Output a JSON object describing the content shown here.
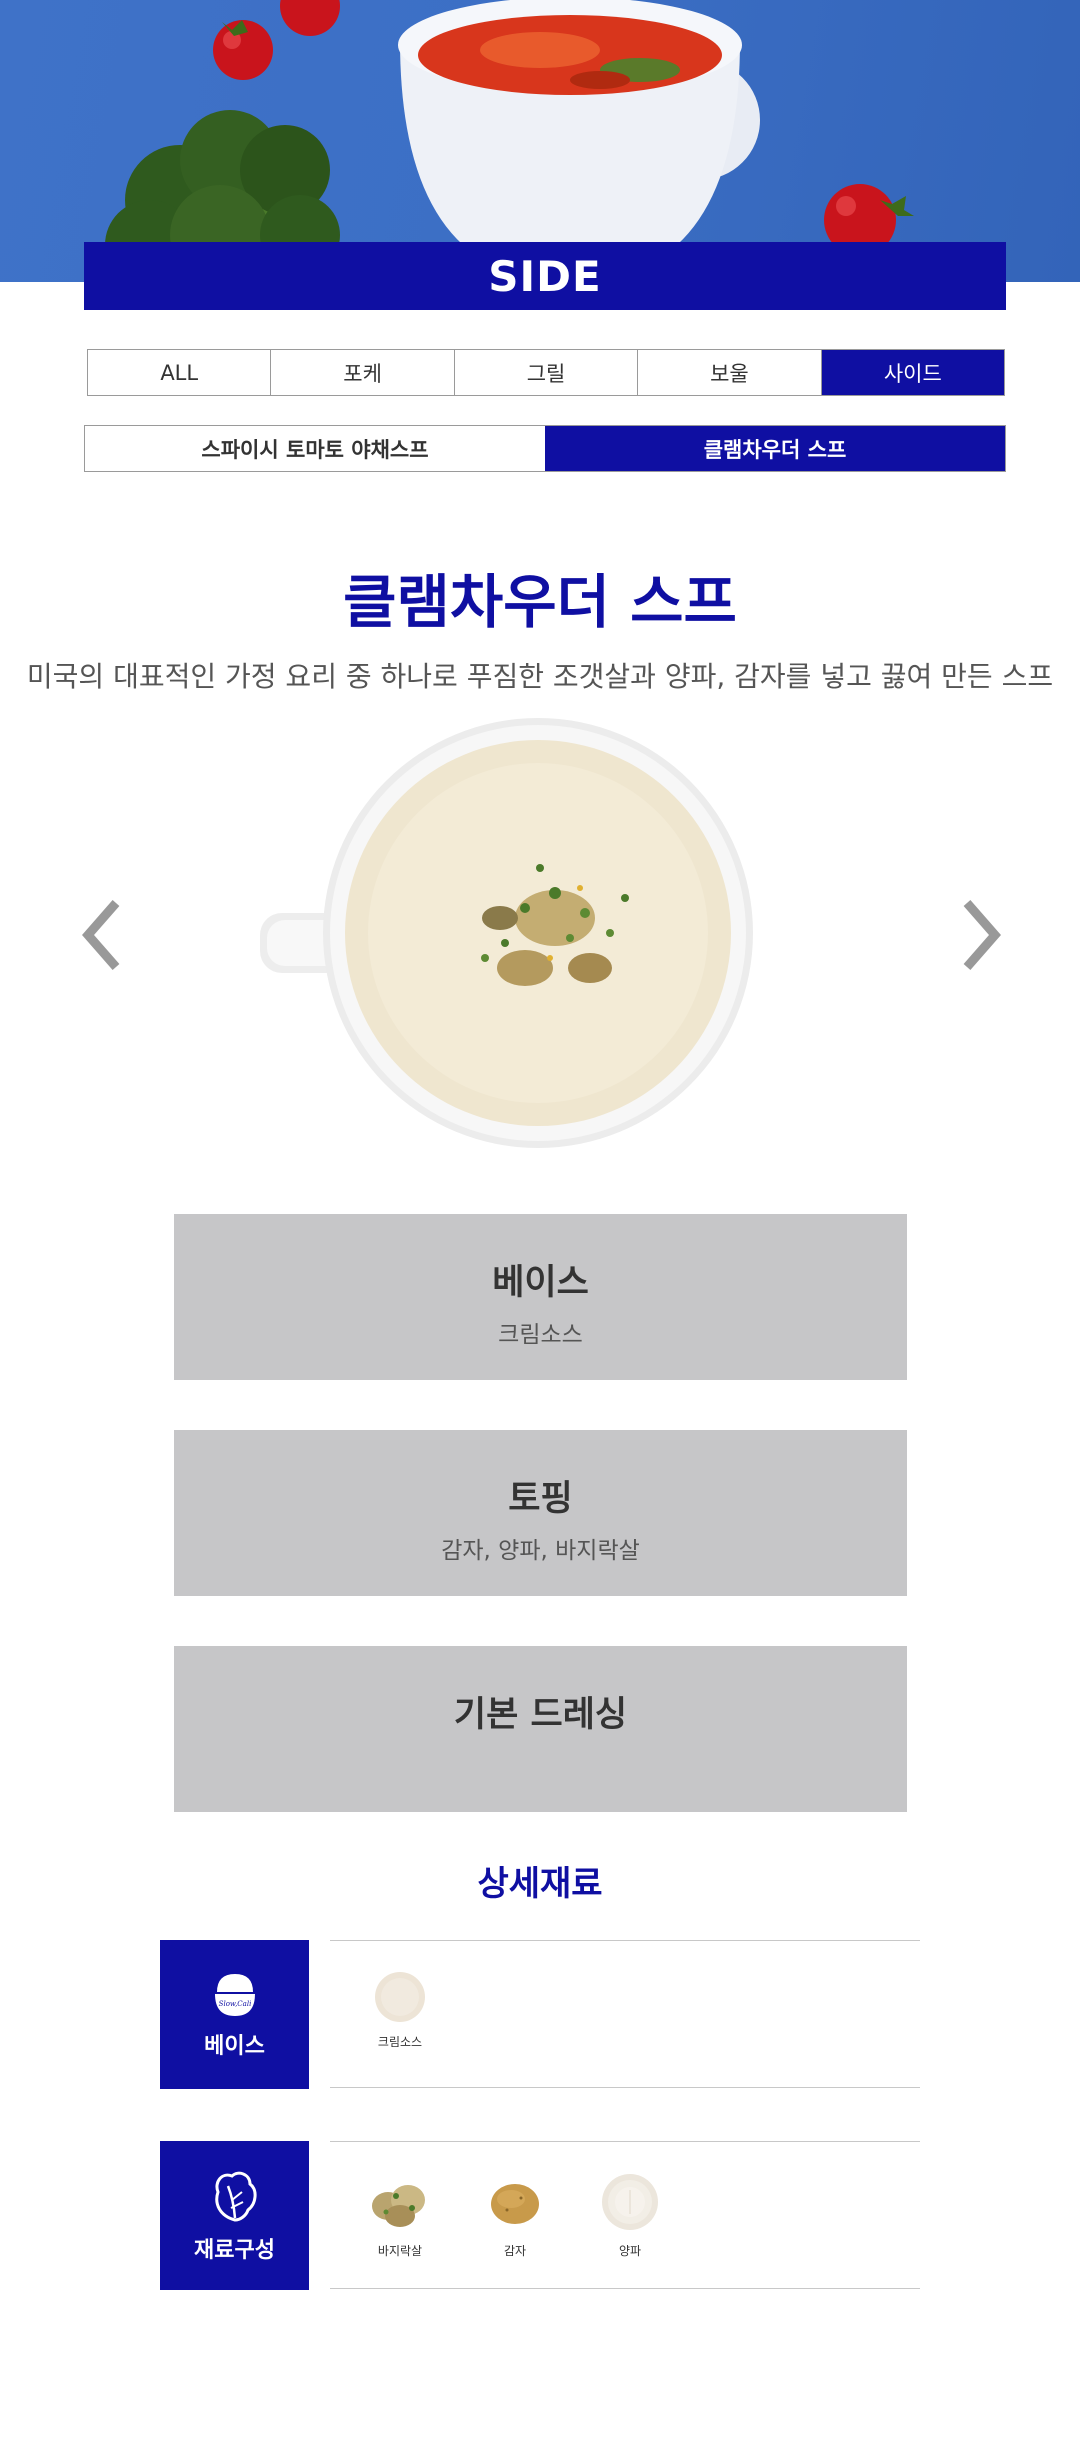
{
  "hero": {
    "banner": "SIDE"
  },
  "category_tabs": [
    {
      "label": "ALL",
      "active": false
    },
    {
      "label": "포케",
      "active": false
    },
    {
      "label": "그릴",
      "active": false
    },
    {
      "label": "보울",
      "active": false
    },
    {
      "label": "사이드",
      "active": true
    }
  ],
  "sub_tabs": [
    {
      "label": "스파이시 토마토 야채스프",
      "active": false
    },
    {
      "label": "클램차우더 스프",
      "active": true
    }
  ],
  "product": {
    "title": "클램차우더 스프",
    "description": "미국의 대표적인 가정 요리 중 하나로 푸짐한 조갯살과 양파, 감자를 넣고 끓여 만든 스프"
  },
  "carousel": {
    "prev_icon": "chevron-left-icon",
    "next_icon": "chevron-right-icon"
  },
  "info": {
    "base_title": "베이스",
    "base_value": "크림소스",
    "topping_title": "토핑",
    "topping_value": "감자, 양파, 바지락살",
    "dressing_title": "기본 드레싱",
    "dressing_value": ""
  },
  "details": {
    "title": "상세재료",
    "base_label": "베이스",
    "base_logo_text": "Slow,Cali",
    "base_items": [
      {
        "name": "크림소스"
      }
    ],
    "ingredients_label": "재료구성",
    "ingredient_items": [
      {
        "name": "바지락살"
      },
      {
        "name": "감자"
      },
      {
        "name": "양파"
      }
    ]
  },
  "colors": {
    "brand": "#0f0fa2",
    "box_gray": "#c6c6c8",
    "hero_blue": "#3c6fc5"
  }
}
